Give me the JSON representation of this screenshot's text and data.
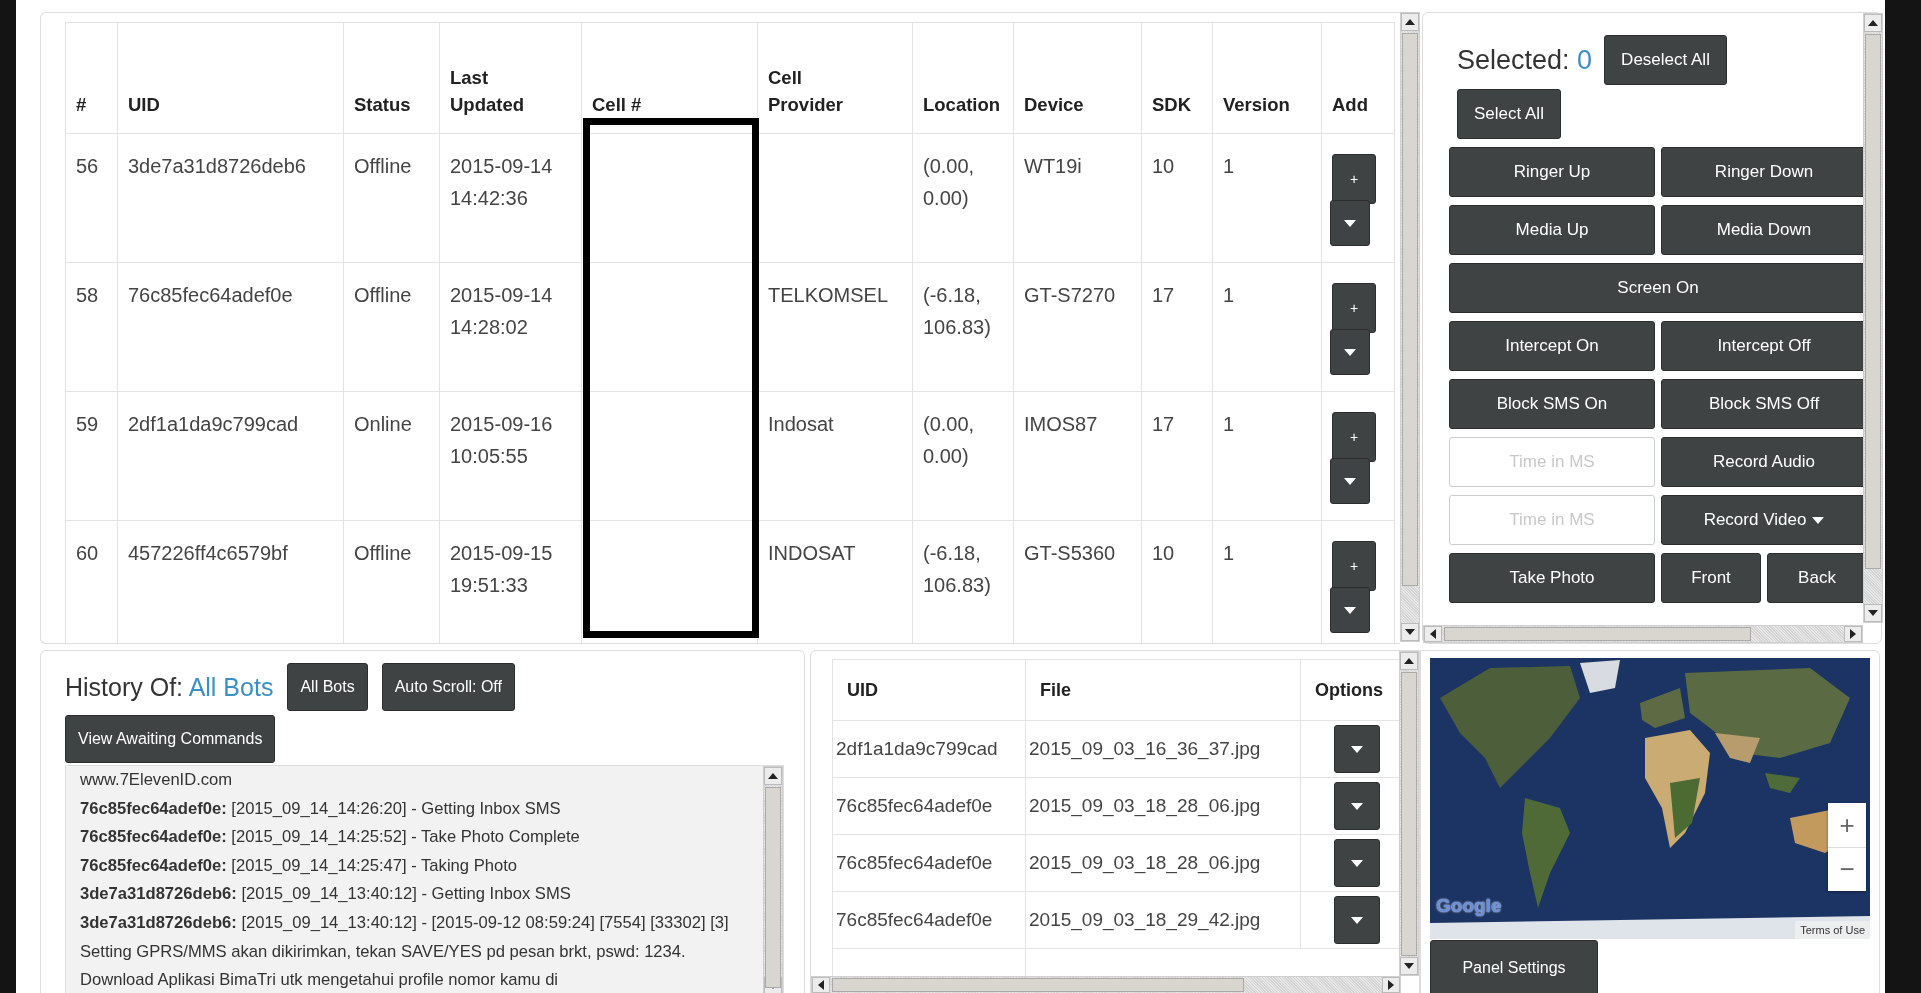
{
  "bots_table": {
    "columns": [
      "#",
      "UID",
      "Status",
      "Last Updated",
      "Cell #",
      "Cell Provider",
      "Location",
      "Device",
      "SDK",
      "Version",
      "Add"
    ],
    "rows": [
      {
        "id": "56",
        "uid": "3de7a31d8726deb6",
        "status": "Offline",
        "last_updated": "2015-09-14 14:42:36",
        "location": "(0.00, 0.00)",
        "device": "WT19i",
        "sdk": "10",
        "version": "1",
        "add_button": "+"
      },
      {
        "id": "58",
        "uid": "76c85fec64adef0e",
        "status": "Offline",
        "last_updated": "2015-09-14 14:28:02",
        "cell_provider": "TELKOMSEL",
        "location": "(-6.18, 106.83)",
        "device": "GT-S7270",
        "sdk": "17",
        "version": "1",
        "add_button": "+"
      },
      {
        "id": "59",
        "uid": "2df1a1da9c799cad",
        "status": "Online",
        "last_updated": "2015-09-16 10:05:55",
        "cell_provider": "Indosat",
        "location": "(0.00, 0.00)",
        "device": "IMOS87",
        "sdk": "17",
        "version": "1",
        "add_button": "+"
      },
      {
        "id": "60",
        "uid": "457226ff4c6579bf",
        "status": "Offline",
        "last_updated": "2015-09-15 19:51:33",
        "cell_provider": "INDOSAT",
        "location": "(-6.18, 106.83)",
        "device": "GT-S5360",
        "sdk": "10",
        "version": "1",
        "add_button": "+"
      }
    ]
  },
  "control_panel": {
    "selected_label": "Selected:",
    "selected_count": "0",
    "deselect_all_button": "Deselect All",
    "select_all_button": "Select All",
    "rows": [
      [
        {
          "kind": "button",
          "label": "Ringer Up"
        },
        {
          "kind": "button",
          "label": "Ringer Down"
        }
      ],
      [
        {
          "kind": "button",
          "label": "Media Up"
        },
        {
          "kind": "button",
          "label": "Media Down"
        }
      ],
      [
        {
          "kind": "button",
          "label": "Screen On"
        }
      ],
      [
        {
          "kind": "button",
          "label": "Intercept On"
        },
        {
          "kind": "button",
          "label": "Intercept Off"
        }
      ],
      [
        {
          "kind": "button",
          "label": "Block SMS On"
        },
        {
          "kind": "button",
          "label": "Block SMS Off"
        }
      ],
      [
        {
          "kind": "field",
          "placeholder": "Time in MS"
        },
        {
          "kind": "button",
          "label": "Record Audio"
        }
      ],
      [
        {
          "kind": "field",
          "placeholder": "Time in MS"
        },
        {
          "kind": "dropdown",
          "label": "Record Video"
        }
      ],
      [
        {
          "kind": "button",
          "label": "Take Photo"
        },
        {
          "kind": "small",
          "label": "Front"
        },
        {
          "kind": "small",
          "label": "Back"
        }
      ]
    ]
  },
  "history": {
    "title": "History Of:",
    "target": "All Bots",
    "all_bots_button": "All Bots",
    "auto_scroll_button": "Auto Scroll: Off",
    "awaiting_button": "View Awaiting Commands",
    "log": [
      "www.7ElevenID.com",
      "**76c85fec64adef0e:** [2015_09_14_14:26:20] - Getting Inbox SMS",
      "**76c85fec64adef0e:** [2015_09_14_14:25:52] - Take Photo Complete",
      "**76c85fec64adef0e:** [2015_09_14_14:25:47] - Taking Photo",
      "**3de7a31d8726deb6:** [2015_09_14_13:40:12] - Getting Inbox SMS",
      "**3de7a31d8726deb6:** [2015_09_14_13:40:12] - [2015-09-12 08:59:24] [7554] [33302] [3] Setting GPRS/MMS akan dikirimkan, tekan SAVE/YES pd pesan brkt, pswd: 1234. Download Aplikasi BimaTri utk mengetahui profile nomor kamu di"
    ]
  },
  "files_table": {
    "columns": [
      "UID",
      "File",
      "Options"
    ],
    "rows": [
      {
        "uid": "2df1a1da9c799cad",
        "file": "2015_09_03_16_36_37.jpg"
      },
      {
        "uid": "76c85fec64adef0e",
        "file": "2015_09_03_18_28_06.jpg"
      },
      {
        "uid": "76c85fec64adef0e",
        "file": "2015_09_03_18_28_06.jpg"
      },
      {
        "uid": "76c85fec64adef0e",
        "file": "2015_09_03_18_29_42.jpg"
      }
    ]
  },
  "map": {
    "zoom_in": "+",
    "zoom_out": "−",
    "logo": "Google",
    "terms": "Terms of Use",
    "panel_settings_button": "Panel Settings"
  }
}
